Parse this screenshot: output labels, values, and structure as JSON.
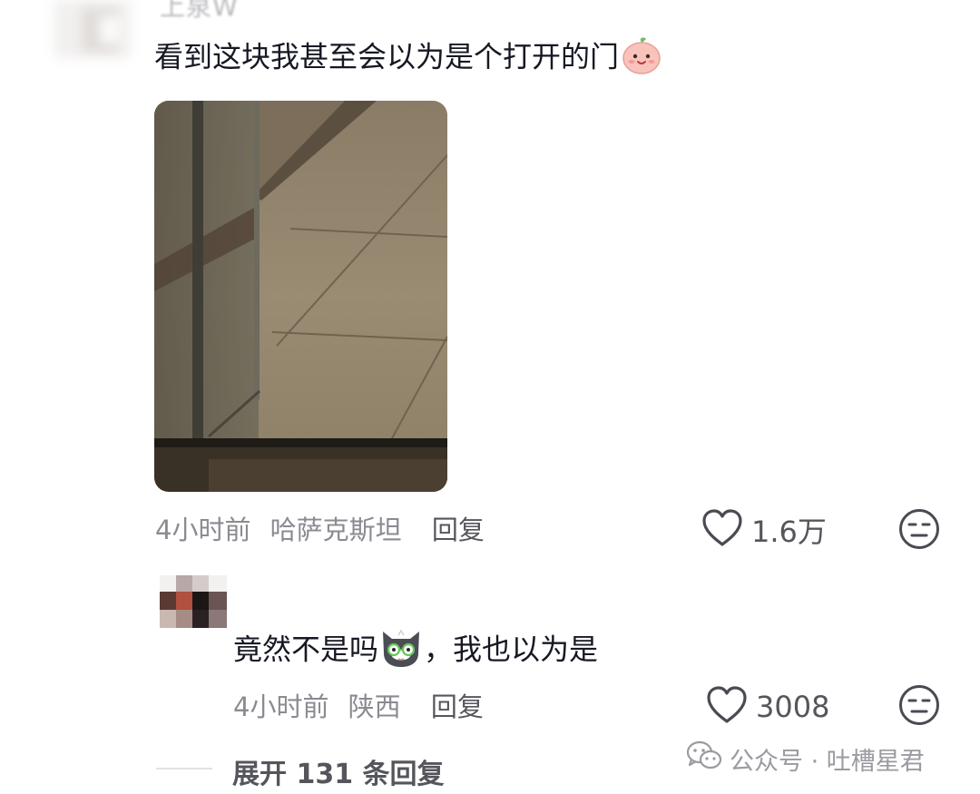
{
  "comment": {
    "username": "上泉W",
    "text": "看到这块我甚至会以为是个打开的门",
    "emoji": "smiling-peach-emoji",
    "photo": "glass-partition-floor-photo",
    "time": "4小时前",
    "location": "哈萨克斯坦",
    "reply_label": "回复",
    "likes": "1.6万"
  },
  "reply": {
    "text_before": "竟然不是吗",
    "emoji": "cat-glasses-emoji",
    "text_after": "，我也以为是",
    "time": "4小时前",
    "location": "陕西",
    "reply_label": "回复",
    "likes": "3008"
  },
  "expand": {
    "label": "展开 131 条回复"
  },
  "watermark": {
    "label": "公众号 · 吐槽星君"
  },
  "icons": {
    "like": "heart-outline-icon",
    "dislike": "neutral-face-icon",
    "wechat": "wechat-icon"
  },
  "colors": {
    "text": "#161823",
    "meta": "#8a8b91",
    "secondary": "#55565c"
  }
}
